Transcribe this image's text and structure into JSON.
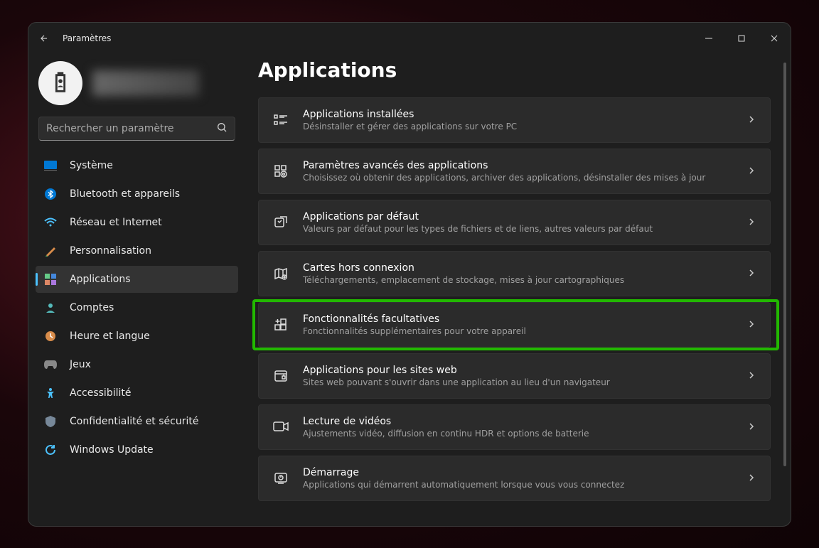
{
  "window": {
    "title": "Paramètres"
  },
  "search": {
    "placeholder": "Rechercher un paramètre"
  },
  "sidebar": {
    "items": [
      {
        "label": "Système"
      },
      {
        "label": "Bluetooth et appareils"
      },
      {
        "label": "Réseau et Internet"
      },
      {
        "label": "Personnalisation"
      },
      {
        "label": "Applications"
      },
      {
        "label": "Comptes"
      },
      {
        "label": "Heure et langue"
      },
      {
        "label": "Jeux"
      },
      {
        "label": "Accessibilité"
      },
      {
        "label": "Confidentialité et sécurité"
      },
      {
        "label": "Windows Update"
      }
    ]
  },
  "page": {
    "title": "Applications",
    "cards": [
      {
        "title": "Applications installées",
        "sub": "Désinstaller et gérer des applications sur votre PC"
      },
      {
        "title": "Paramètres avancés des applications",
        "sub": "Choisissez où obtenir des applications, archiver des applications, désinstaller des mises à jour"
      },
      {
        "title": "Applications par défaut",
        "sub": "Valeurs par défaut pour les types de fichiers et de liens, autres valeurs par défaut"
      },
      {
        "title": "Cartes hors connexion",
        "sub": "Téléchargements, emplacement de stockage, mises à jour cartographiques"
      },
      {
        "title": "Fonctionnalités facultatives",
        "sub": "Fonctionnalités supplémentaires pour votre appareil"
      },
      {
        "title": "Applications pour les sites web",
        "sub": "Sites web pouvant s'ouvrir dans une application au lieu d'un navigateur"
      },
      {
        "title": "Lecture de vidéos",
        "sub": "Ajustements vidéo, diffusion en continu HDR et options de batterie"
      },
      {
        "title": "Démarrage",
        "sub": "Applications qui démarrent automatiquement lorsque vous vous connectez"
      }
    ]
  }
}
